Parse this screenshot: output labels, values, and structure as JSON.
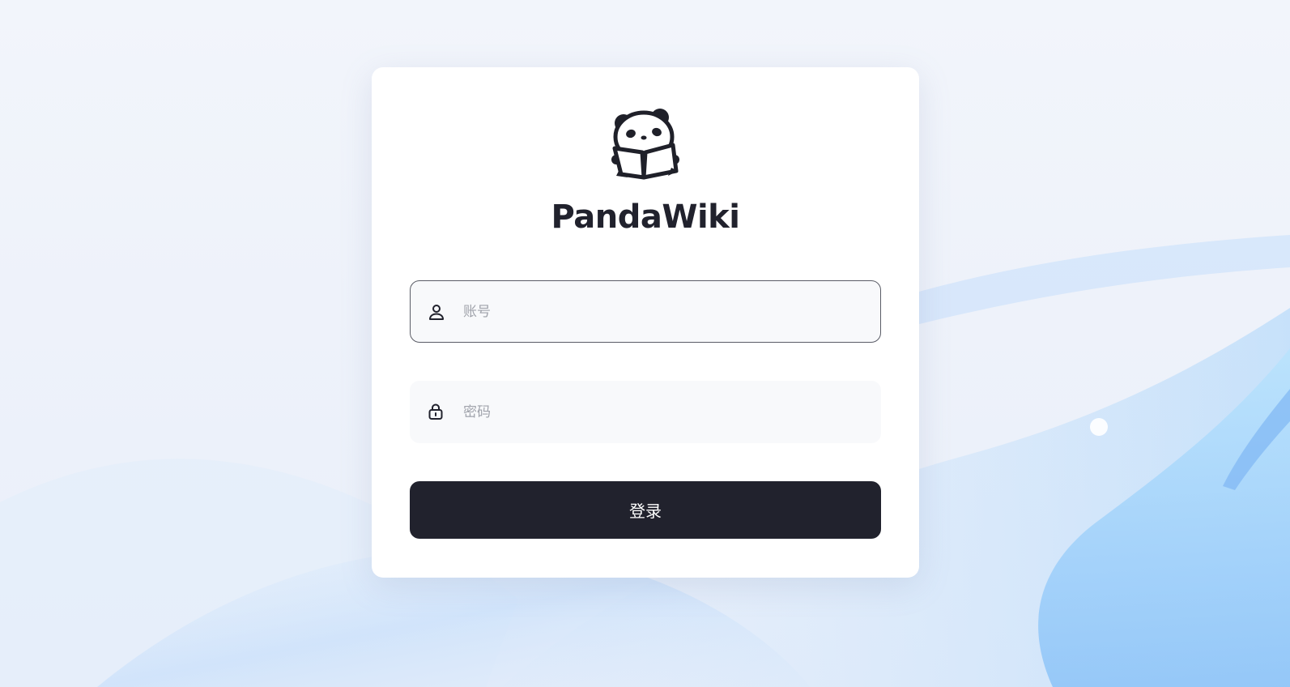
{
  "brand": {
    "name": "PandaWiki",
    "logo_icon": "panda-reading-book-icon"
  },
  "form": {
    "account": {
      "placeholder": "账号",
      "value": "",
      "icon": "user-icon"
    },
    "password": {
      "placeholder": "密码",
      "value": "",
      "icon": "lock-icon"
    },
    "submit_label": "登录"
  },
  "colors": {
    "primary": "#21222d",
    "input_bg": "#f8f9fb",
    "placeholder": "#a0a3ab",
    "card_bg": "#ffffff",
    "page_bg": "#eef2fa",
    "accent_wave": "#a9d1fb"
  }
}
